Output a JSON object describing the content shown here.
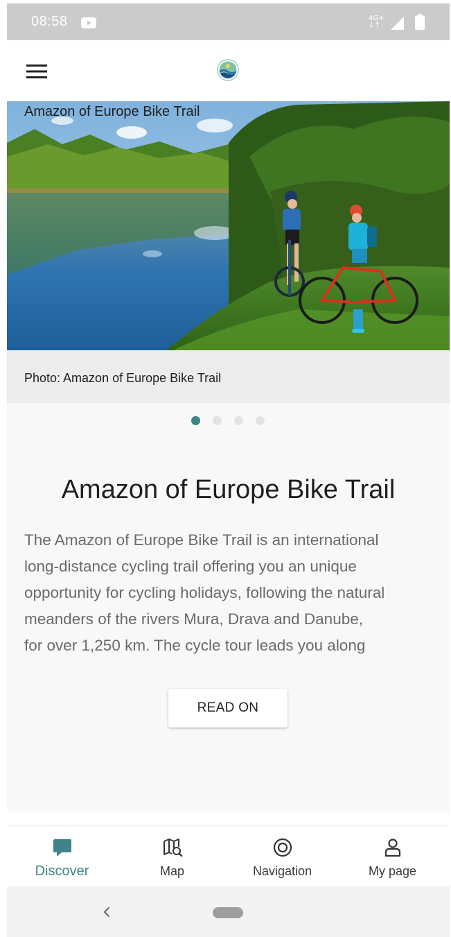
{
  "status_bar": {
    "time": "08:58",
    "network_badge": "4G+",
    "icons": [
      "youtube-icon",
      "network-4g-icon",
      "signal-icon",
      "battery-icon"
    ]
  },
  "app_bar": {
    "icons": [
      "menu-icon",
      "app-logo-icon"
    ]
  },
  "hero": {
    "title": "Amazon of Europe Bike Trail",
    "caption": "Photo: Amazon of Europe Bike Trail",
    "pager": {
      "count": 4,
      "active_index": 0
    }
  },
  "article": {
    "title": "Amazon of Europe Bike Trail",
    "body_lines": [
      "The Amazon of Europe Bike Trail is an international",
      "long-distance cycling trail offering you an unique",
      "opportunity for cycling holidays, following the natural",
      "meanders of the rivers Mura, Drava and Danube,",
      "for over 1,250 km. The cycle tour leads you along"
    ],
    "read_on_label": "READ ON"
  },
  "bottom_nav": {
    "items": [
      {
        "label": "Discover",
        "icon": "chat-bubble-icon",
        "active": true
      },
      {
        "label": "Map",
        "icon": "map-search-icon",
        "active": false
      },
      {
        "label": "Navigation",
        "icon": "target-icon",
        "active": false
      },
      {
        "label": "My page",
        "icon": "user-icon",
        "active": false
      }
    ]
  },
  "system_nav": {
    "icons": [
      "back-icon",
      "home-pill-icon"
    ]
  },
  "colors": {
    "accent": "#3e8589",
    "status_bar": "#cbcbcb",
    "body_text": "#6a6a6a"
  }
}
